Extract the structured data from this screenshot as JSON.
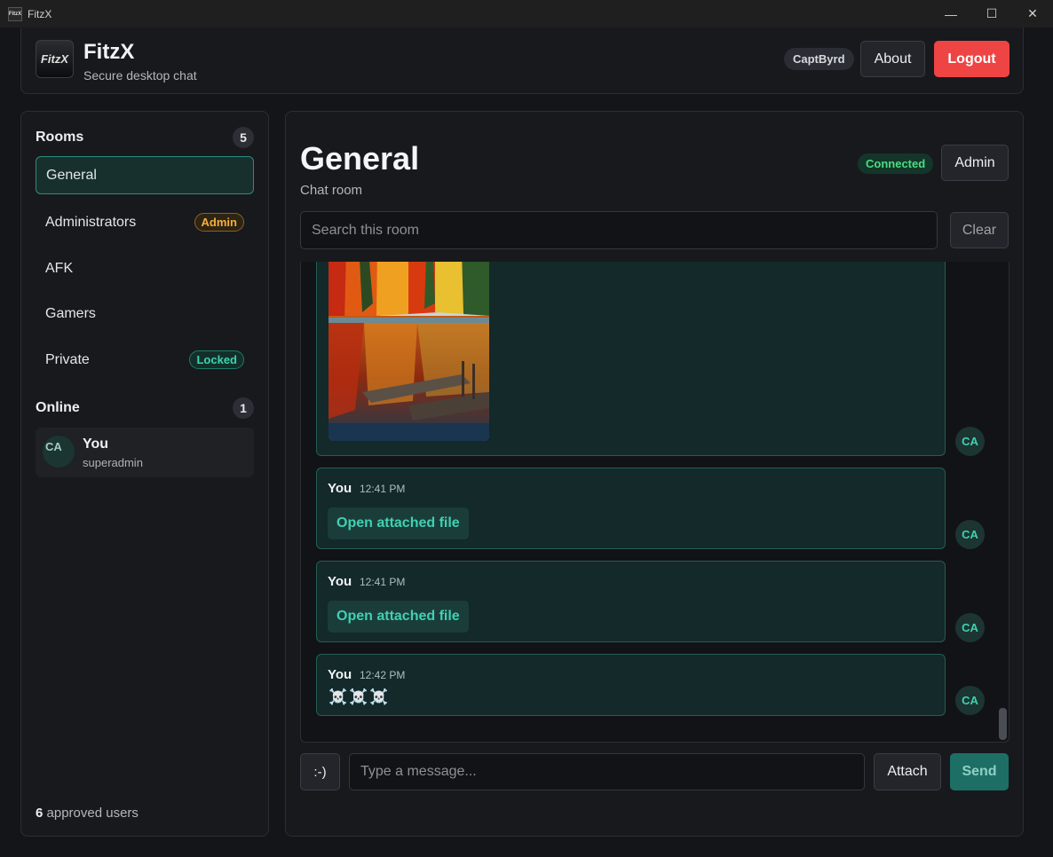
{
  "window": {
    "title": "FitzX",
    "icon_text": "FitzX",
    "min": "—",
    "max": "☐",
    "close": "✕"
  },
  "header": {
    "logo_text": "FitzX",
    "title": "FitzX",
    "subtitle": "Secure desktop chat",
    "username": "CaptByrd",
    "about_label": "About",
    "logout_label": "Logout"
  },
  "sidebar": {
    "rooms_label": "Rooms",
    "rooms_count": "5",
    "rooms": [
      {
        "name": "General",
        "tag": ""
      },
      {
        "name": "Administrators",
        "tag": "Admin"
      },
      {
        "name": "AFK",
        "tag": ""
      },
      {
        "name": "Gamers",
        "tag": ""
      },
      {
        "name": "Private",
        "tag": "Locked"
      }
    ],
    "online_label": "Online",
    "online_count": "1",
    "online_users": [
      {
        "initials": "CA",
        "name": "You",
        "role": "superadmin"
      }
    ],
    "approved_count": "6",
    "approved_text": "approved users"
  },
  "room": {
    "title": "General",
    "subtitle": "Chat room",
    "status": "Connected",
    "admin_label": "Admin",
    "search_placeholder": "Search this room",
    "clear_label": "Clear"
  },
  "messages": [
    {
      "type": "image",
      "avatar": "CA"
    },
    {
      "author": "You",
      "time": "12:41 PM",
      "link": "Open attached file",
      "avatar": "CA"
    },
    {
      "author": "You",
      "time": "12:41 PM",
      "link": "Open attached file",
      "avatar": "CA"
    },
    {
      "author": "You",
      "time": "12:42 PM",
      "text": "☠️☠️☠️",
      "avatar": "CA"
    }
  ],
  "composer": {
    "emoji_label": ":-)",
    "placeholder": "Type a message...",
    "attach_label": "Attach",
    "send_label": "Send"
  },
  "colors": {
    "accent": "#3fd1b3",
    "logout": "#ef4444",
    "connected": "#4ade80",
    "admin_tag": "#f5b03a"
  }
}
